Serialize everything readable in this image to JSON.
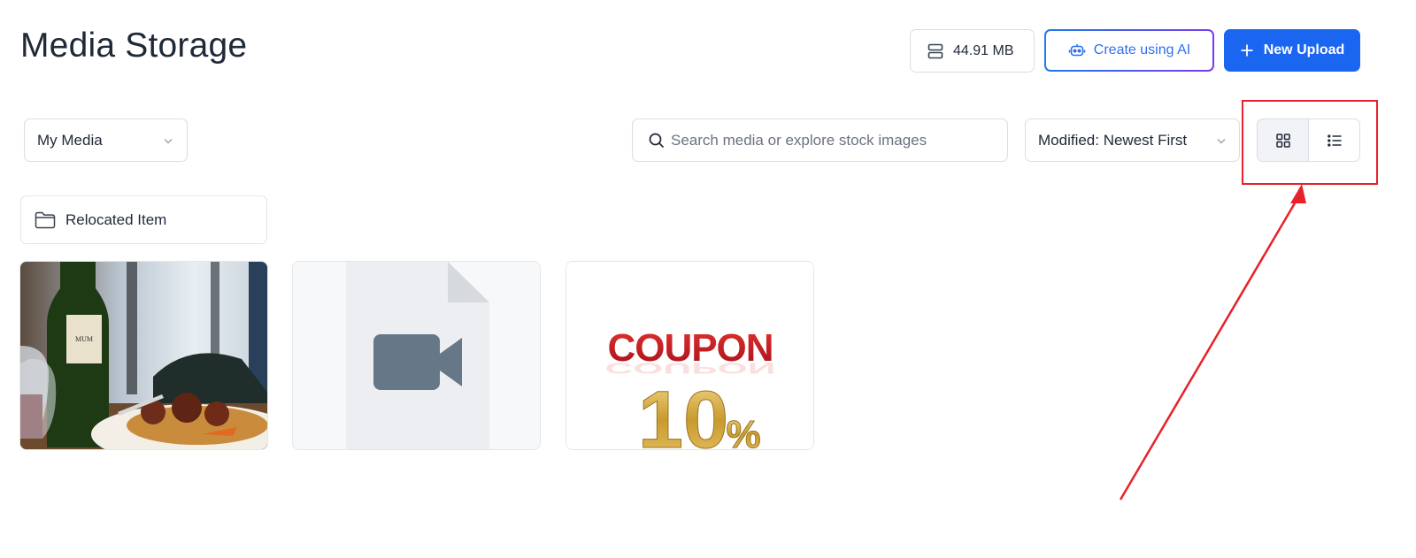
{
  "header": {
    "title": "Media Storage",
    "storage_used": "44.91 MB",
    "ai_button_label": "Create using AI",
    "upload_button_label": "New Upload"
  },
  "toolbar": {
    "folder_select_value": "My Media",
    "search_placeholder": "Search media or explore stock images",
    "sort_value": "Modified: Newest First",
    "view_modes": [
      "grid",
      "list"
    ],
    "active_view": "grid"
  },
  "folders": [
    {
      "name": "Relocated Item",
      "icon": "folder-icon"
    }
  ],
  "media": [
    {
      "type": "image",
      "description_icon": "photo"
    },
    {
      "type": "video",
      "description_icon": "video-camera-icon"
    },
    {
      "type": "image",
      "text": "COUPON",
      "subtext": "10%"
    }
  ],
  "colors": {
    "primary": "#1a66f0",
    "ai_gradient_start": "#1d7ae6",
    "ai_gradient_end": "#7c3aed",
    "annotation": "#e8212a",
    "coupon_red": "#c8102e",
    "gold": "#c99a2e"
  }
}
